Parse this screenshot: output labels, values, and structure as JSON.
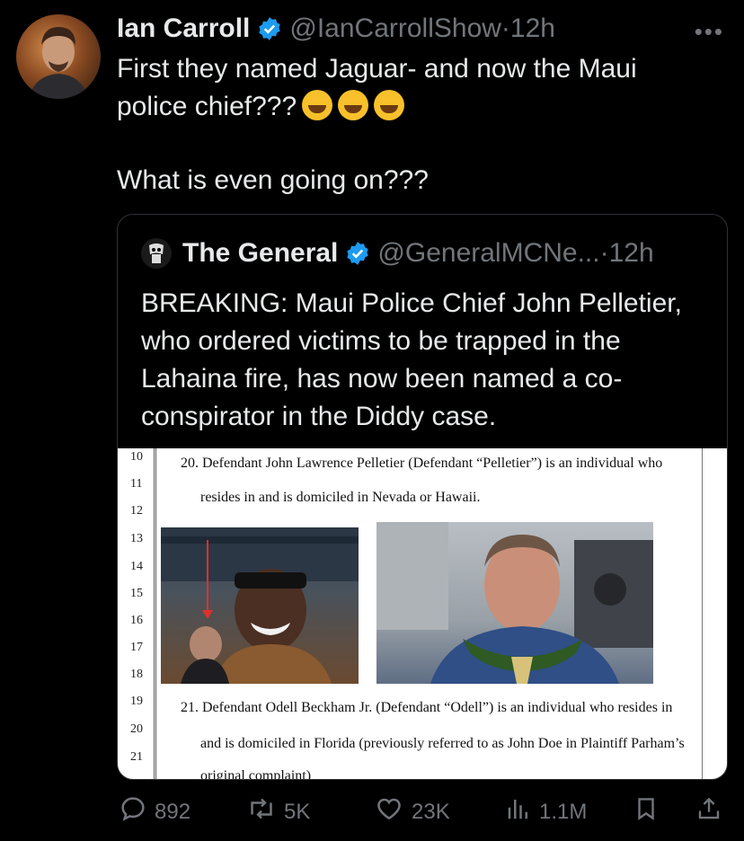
{
  "author": {
    "name": "Ian Carroll",
    "handle": "@IanCarrollShow",
    "separator": "·",
    "time": "12h"
  },
  "more_label": "•••",
  "tweet": {
    "line1": "First they named Jaguar- and now the Maui",
    "line2": "police chief???",
    "line3": "What is even going on???",
    "emojis": [
      "rolling-on-floor-laughing-emoji",
      "rolling-on-floor-laughing-emoji",
      "rolling-on-floor-laughing-emoji"
    ]
  },
  "quote": {
    "name": "The General",
    "handle": "@GeneralMCNe...",
    "separator": "·",
    "time": "12h",
    "text": "BREAKING: Maui Police Chief John Pelletier, who ordered victims to be trapped in the Lahaina fire, has now been named a co-conspirator in the Diddy case.",
    "document": {
      "line_numbers": [
        "10",
        "11",
        "12",
        "13",
        "14",
        "15",
        "16",
        "17",
        "18",
        "19",
        "20",
        "21"
      ],
      "para20_a": "20. Defendant John Lawrence Pelletier (Defendant “Pelletier”) is an individual who",
      "para20_b": "resides in and is domiciled in Nevada or Hawaii.",
      "para21_a": "21. Defendant Odell Beckham Jr. (Defendant “Odell”)  is an individual who resides in",
      "para21_b": "and is domiciled in Florida (previously referred to as John Doe in Plaintiff Parham’s",
      "para21_c": "original complaint)"
    }
  },
  "actions": {
    "replies": "892",
    "reposts": "5K",
    "likes": "23K",
    "views": "1.1M"
  },
  "colors": {
    "background": "#000000",
    "text": "#e7e9ea",
    "muted": "#71767b",
    "verified": "#1d9bf0",
    "border": "#2f3336"
  }
}
